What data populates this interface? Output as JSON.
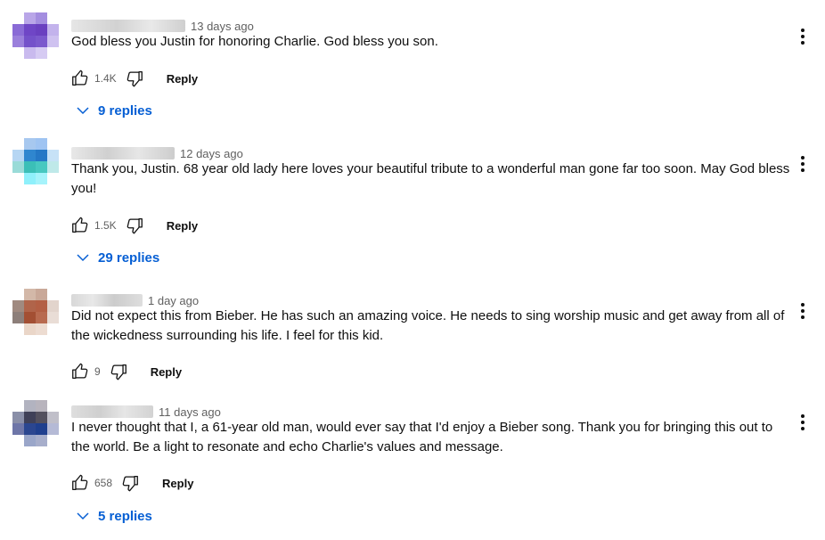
{
  "comments": [
    {
      "timestamp": "13 days ago",
      "text": "God bless you Justin for honoring Charlie. God bless you son.",
      "likes": "1.4K",
      "reply_label": "Reply",
      "replies_label": "9 replies"
    },
    {
      "timestamp": "12 days ago",
      "text": "Thank you, Justin.  68 year old lady here loves your beautiful tribute to a wonderful man gone far too soon.  May God bless you!",
      "likes": "1.5K",
      "reply_label": "Reply",
      "replies_label": "29 replies"
    },
    {
      "timestamp": "1 day ago",
      "text": "Did not expect this from Bieber. He has such an amazing voice. He needs to sing worship music and get away from all of the wickedness surrounding his life. I feel for this kid.",
      "likes": "9",
      "reply_label": "Reply"
    },
    {
      "timestamp": "11 days ago",
      "text": "I never thought that I, a 61-year old man, would ever say that I'd enjoy a Bieber song. Thank you for bringing this out to the world. Be a light to resonate and echo Charlie's values and message.",
      "likes": "658",
      "reply_label": "Reply",
      "replies_label": "5 replies"
    }
  ],
  "icons": {
    "like": "thumbs-up-icon",
    "dislike": "thumbs-down-icon",
    "menu": "more-vert-icon",
    "expand": "chevron-down-icon"
  },
  "colors": {
    "link": "#065fd4",
    "secondary_text": "#606060",
    "primary_text": "#0f0f0f"
  }
}
